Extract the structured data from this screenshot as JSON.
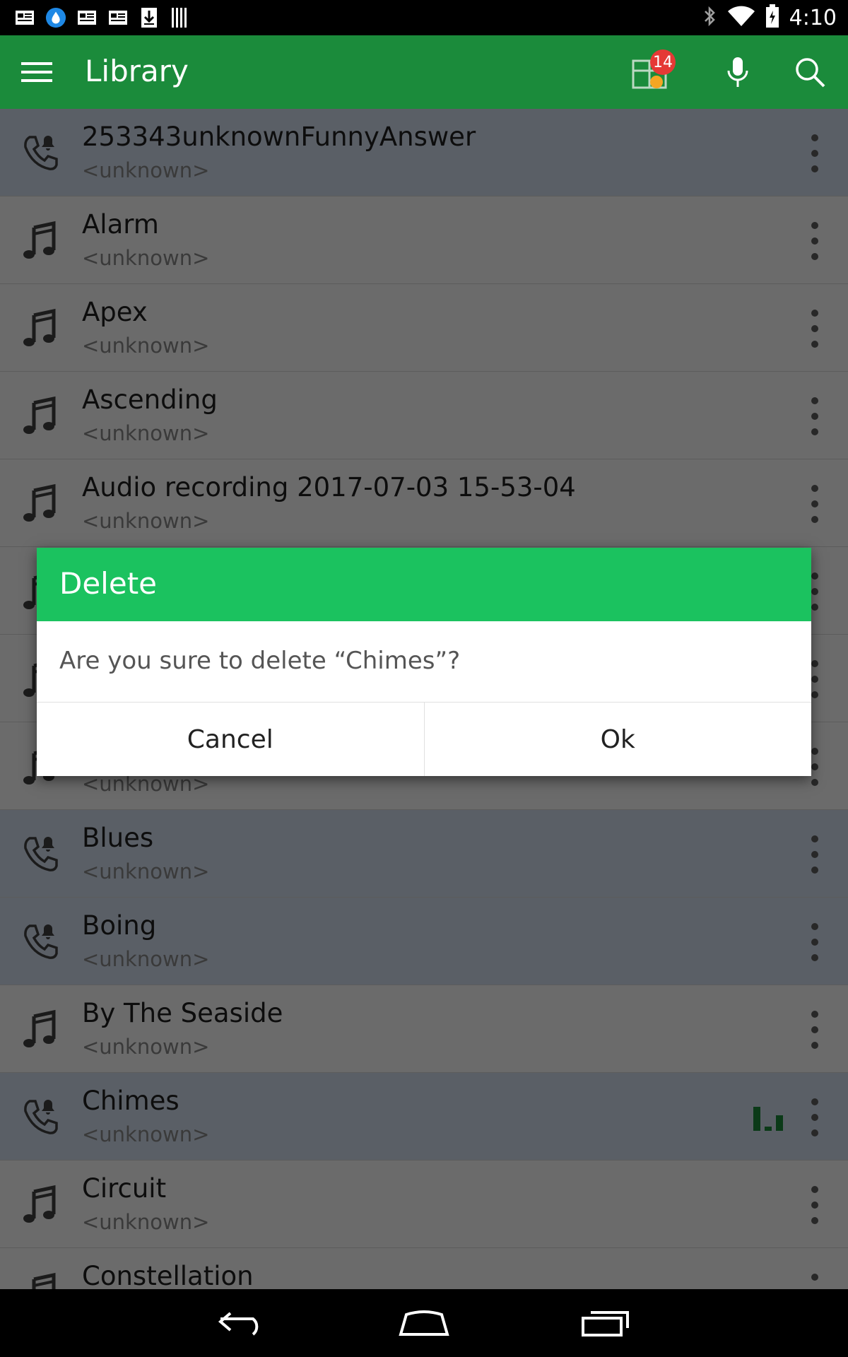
{
  "status_bar": {
    "time": "4:10",
    "left_icons": [
      "newspaper-icon",
      "droplet-app-icon",
      "newspaper-icon",
      "newspaper-icon",
      "download-icon",
      "barcode-icon"
    ],
    "right_icons": [
      "bluetooth-icon",
      "wifi-icon",
      "battery-icon"
    ]
  },
  "app_bar": {
    "title": "Library",
    "badge_count": "14",
    "colors": {
      "background": "#1b8b3b"
    }
  },
  "list": {
    "items": [
      {
        "title": "253343unknownFunnyAnswer",
        "subtitle": "<unknown>",
        "icon": "ringtone-phone-icon",
        "highlight": true
      },
      {
        "title": "Alarm",
        "subtitle": "<unknown>",
        "icon": "music-note-icon",
        "highlight": false
      },
      {
        "title": "Apex",
        "subtitle": "<unknown>",
        "icon": "music-note-icon",
        "highlight": false
      },
      {
        "title": "Ascending",
        "subtitle": "<unknown>",
        "icon": "music-note-icon",
        "highlight": false
      },
      {
        "title": "Audio recording 2017-07-03 15-53-04",
        "subtitle": "<unknown>",
        "icon": "music-note-icon",
        "highlight": false
      },
      {
        "title": "",
        "subtitle": "",
        "icon": "music-note-icon",
        "highlight": false
      },
      {
        "title": "",
        "subtitle": "",
        "icon": "music-note-icon",
        "highlight": false
      },
      {
        "title": "",
        "subtitle": "<unknown>",
        "icon": "music-note-icon",
        "highlight": false
      },
      {
        "title": "Blues",
        "subtitle": "<unknown>",
        "icon": "ringtone-phone-icon",
        "highlight": true
      },
      {
        "title": "Boing",
        "subtitle": "<unknown>",
        "icon": "ringtone-phone-icon",
        "highlight": true
      },
      {
        "title": "By The Seaside",
        "subtitle": "<unknown>",
        "icon": "music-note-icon",
        "highlight": false
      },
      {
        "title": "Chimes",
        "subtitle": "<unknown>",
        "icon": "ringtone-phone-icon",
        "highlight": true,
        "playing": true
      },
      {
        "title": "Circuit",
        "subtitle": "<unknown>",
        "icon": "music-note-icon",
        "highlight": false
      },
      {
        "title": "Constellation",
        "subtitle": "",
        "icon": "music-note-icon",
        "highlight": false
      }
    ]
  },
  "dialog": {
    "title": "Delete",
    "message": "Are you sure to delete “Chimes”?",
    "cancel_label": "Cancel",
    "ok_label": "Ok",
    "colors": {
      "header": "#1bc25f"
    }
  }
}
